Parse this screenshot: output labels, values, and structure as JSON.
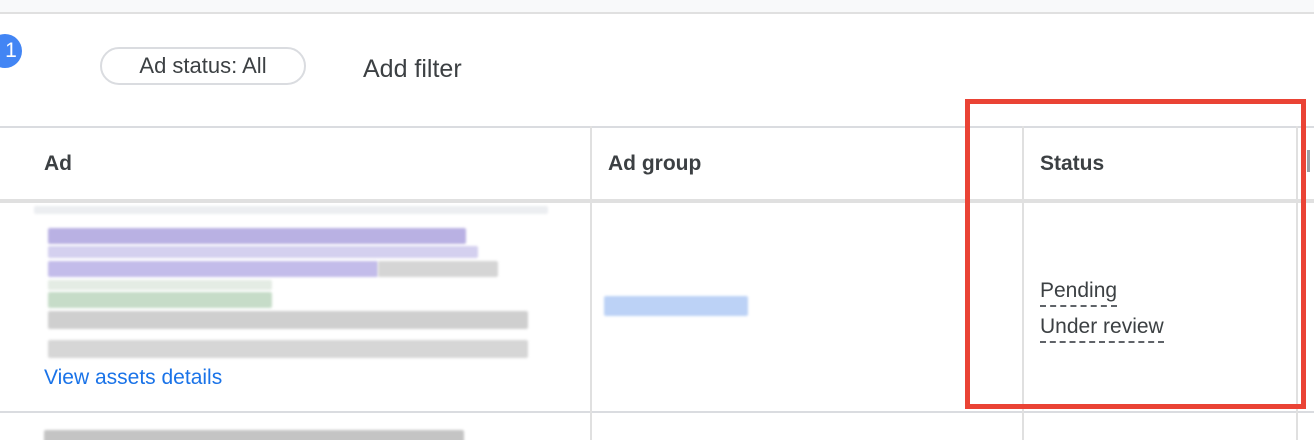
{
  "filter_bar": {
    "step_number": "1",
    "status_chip": "Ad status: All",
    "add_filter": "Add filter"
  },
  "table": {
    "columns": [
      "Ad",
      "Ad group",
      "Status"
    ],
    "rows": [
      {
        "ad_link": "View assets details",
        "status": [
          "Pending",
          "Under review"
        ]
      }
    ]
  },
  "colors": {
    "accent_blue": "#1a73e8",
    "badge_blue": "#4285f4",
    "highlight_red": "#ea4335"
  }
}
